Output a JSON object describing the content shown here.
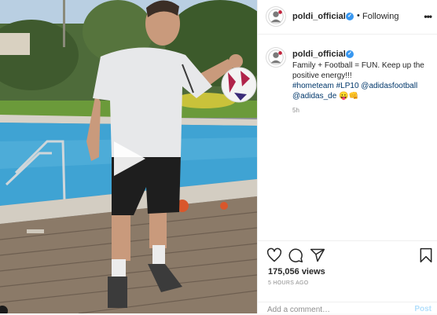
{
  "post": {
    "username": "poldi_official",
    "verified_mark": "✓",
    "separator": "•",
    "follow_state": "Following",
    "caption": {
      "text": "Family + Football = FUN. Keep up the positive energy!!!",
      "tags": [
        "#hometeam",
        "#LP10",
        "@adidasfootball",
        "@adidas_de"
      ],
      "emoji": "😛👊"
    },
    "comment_age": "5h",
    "likes": "175,056 views",
    "posted_at": "5 HOURS AGO",
    "comment_placeholder": "Add a comment…",
    "post_button_label": "Post"
  },
  "icons": {
    "like": "heart-icon",
    "comment": "comment-icon",
    "share": "share-icon",
    "save": "bookmark-icon",
    "play": "play-icon",
    "more": "more-options-icon"
  },
  "colors": {
    "link": "#00376b",
    "verified": "#3897f0",
    "muted": "#8e8e8e",
    "post_disabled": "#b2dffc"
  }
}
